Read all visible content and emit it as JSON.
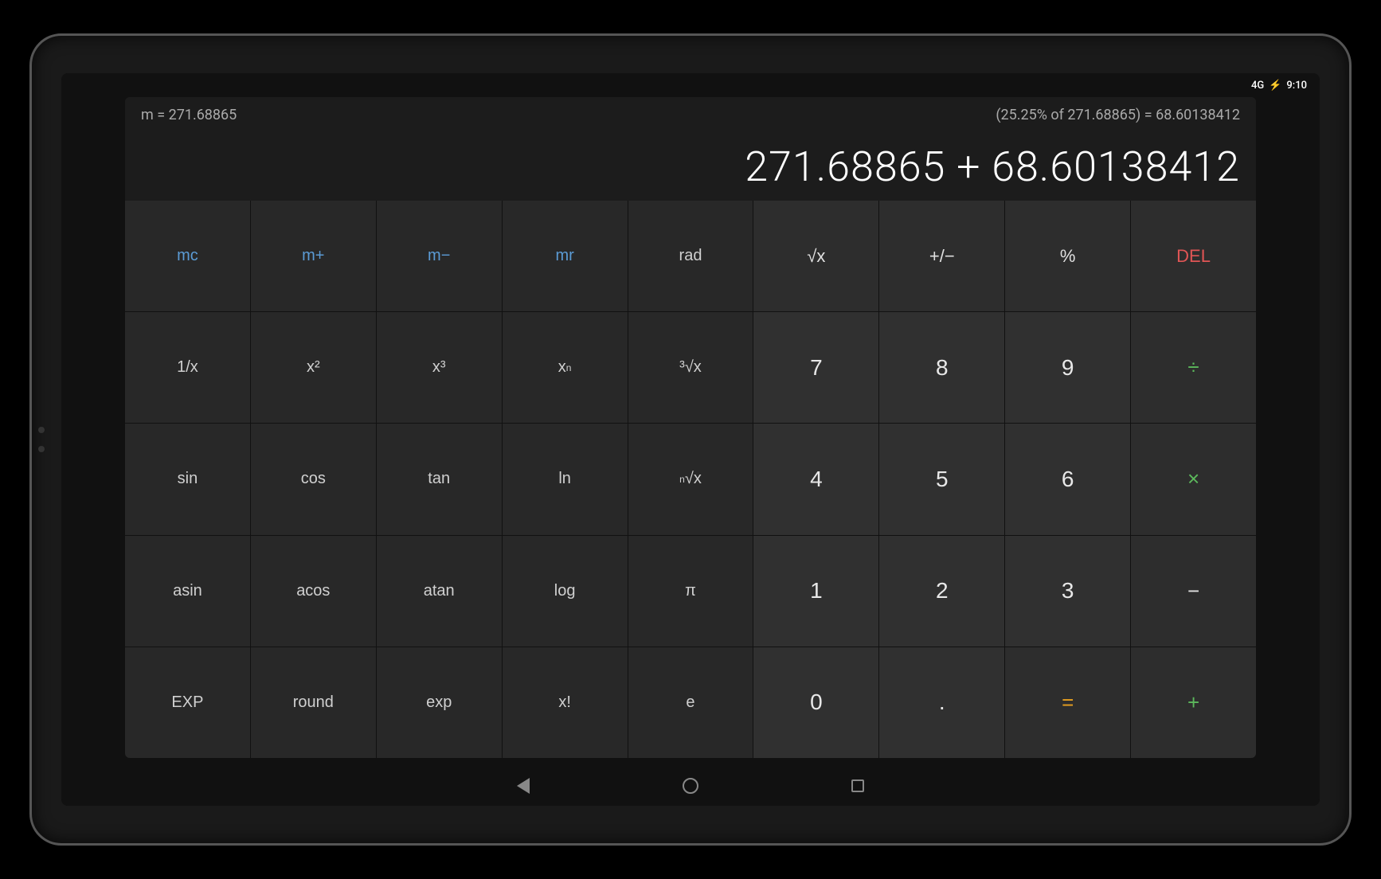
{
  "status_bar": {
    "signal": "4G",
    "battery_icon": "⚡",
    "time": "9:10"
  },
  "display": {
    "memory_label": "m = 271.68865",
    "percentage_label": "(25.25% of 271.68865) = 68.60138412",
    "main_expression": "271.68865 + 68.60138412"
  },
  "buttons": {
    "row1": [
      {
        "id": "mc",
        "label": "mc",
        "type": "mem"
      },
      {
        "id": "mplus",
        "label": "m+",
        "type": "mem"
      },
      {
        "id": "mminus",
        "label": "m−",
        "type": "mem"
      },
      {
        "id": "mr",
        "label": "mr",
        "type": "mem"
      },
      {
        "id": "rad",
        "label": "rad",
        "type": "rad"
      },
      {
        "id": "sqrt",
        "label": "√x",
        "type": "special"
      },
      {
        "id": "plusminus",
        "label": "+/−",
        "type": "special"
      },
      {
        "id": "percent",
        "label": "%",
        "type": "special"
      },
      {
        "id": "del",
        "label": "DEL",
        "type": "del"
      }
    ],
    "row2": [
      {
        "id": "reciprocal",
        "label": "1/x",
        "type": "sci"
      },
      {
        "id": "square",
        "label": "x²",
        "type": "sci"
      },
      {
        "id": "cube",
        "label": "x³",
        "type": "sci"
      },
      {
        "id": "xn",
        "label": "xⁿ",
        "type": "sci"
      },
      {
        "id": "cbrt",
        "label": "³√x",
        "type": "sci"
      },
      {
        "id": "7",
        "label": "7",
        "type": "num"
      },
      {
        "id": "8",
        "label": "8",
        "type": "num"
      },
      {
        "id": "9",
        "label": "9",
        "type": "num"
      },
      {
        "id": "divide",
        "label": "÷",
        "type": "op"
      }
    ],
    "row3": [
      {
        "id": "sin",
        "label": "sin",
        "type": "sci"
      },
      {
        "id": "cos",
        "label": "cos",
        "type": "sci"
      },
      {
        "id": "tan",
        "label": "tan",
        "type": "sci"
      },
      {
        "id": "ln",
        "label": "ln",
        "type": "sci"
      },
      {
        "id": "nrt",
        "label": "ⁿ√x",
        "type": "sci"
      },
      {
        "id": "4",
        "label": "4",
        "type": "num"
      },
      {
        "id": "5",
        "label": "5",
        "type": "num"
      },
      {
        "id": "6",
        "label": "6",
        "type": "num"
      },
      {
        "id": "multiply",
        "label": "×",
        "type": "op"
      }
    ],
    "row4": [
      {
        "id": "asin",
        "label": "asin",
        "type": "sci"
      },
      {
        "id": "acos",
        "label": "acos",
        "type": "sci"
      },
      {
        "id": "atan",
        "label": "atan",
        "type": "sci"
      },
      {
        "id": "log",
        "label": "log",
        "type": "sci"
      },
      {
        "id": "pi",
        "label": "π",
        "type": "sci"
      },
      {
        "id": "1",
        "label": "1",
        "type": "num"
      },
      {
        "id": "2",
        "label": "2",
        "type": "num"
      },
      {
        "id": "3",
        "label": "3",
        "type": "num"
      },
      {
        "id": "subtract",
        "label": "−",
        "type": "minus"
      }
    ],
    "row5": [
      {
        "id": "exp_btn",
        "label": "EXP",
        "type": "sci"
      },
      {
        "id": "round",
        "label": "round",
        "type": "sci"
      },
      {
        "id": "exp",
        "label": "exp",
        "type": "sci"
      },
      {
        "id": "factorial",
        "label": "x!",
        "type": "sci"
      },
      {
        "id": "e",
        "label": "e",
        "type": "sci"
      },
      {
        "id": "0",
        "label": "0",
        "type": "num"
      },
      {
        "id": "dot",
        "label": ".",
        "type": "num"
      },
      {
        "id": "equals",
        "label": "=",
        "type": "equals"
      },
      {
        "id": "add",
        "label": "+",
        "type": "op"
      }
    ]
  },
  "nav": {
    "back": "◁",
    "home": "○",
    "recent": "□"
  },
  "colors": {
    "mem_blue": "#5b9bd5",
    "op_green": "#5cb85c",
    "del_red": "#e05555",
    "equals_orange": "#e8a020",
    "accent": "#fff"
  }
}
